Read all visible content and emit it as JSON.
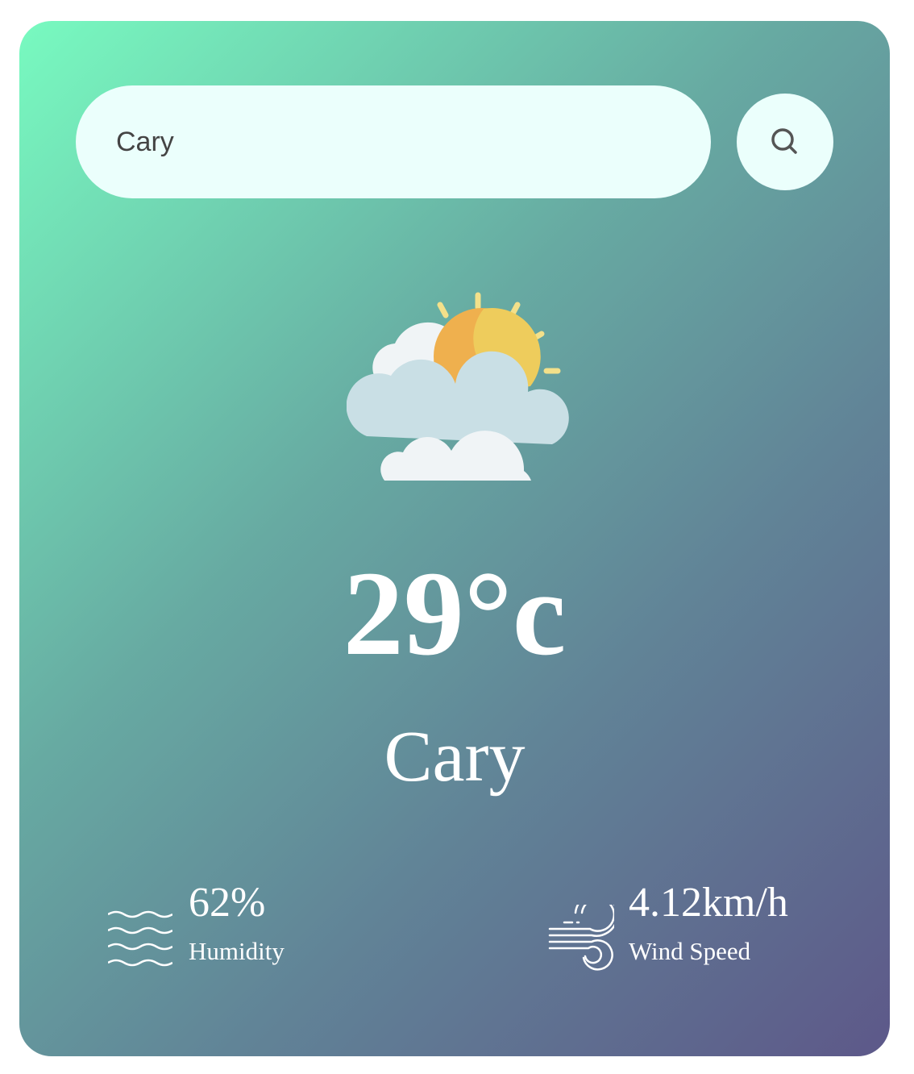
{
  "search": {
    "value": "Cary",
    "icon": "search-icon"
  },
  "weather": {
    "icon": "partly-cloudy-icon",
    "temperature": "29°c",
    "city": "Cary"
  },
  "humidity": {
    "value": "62%",
    "label": "Humidity",
    "icon": "water-waves-icon"
  },
  "wind": {
    "value": "4.12km/h",
    "label": "Wind Speed",
    "icon": "wind-icon"
  },
  "colors": {
    "gradient_start": "#78fac0",
    "gradient_end": "#5d5889",
    "input_bg": "#ebfffc"
  }
}
